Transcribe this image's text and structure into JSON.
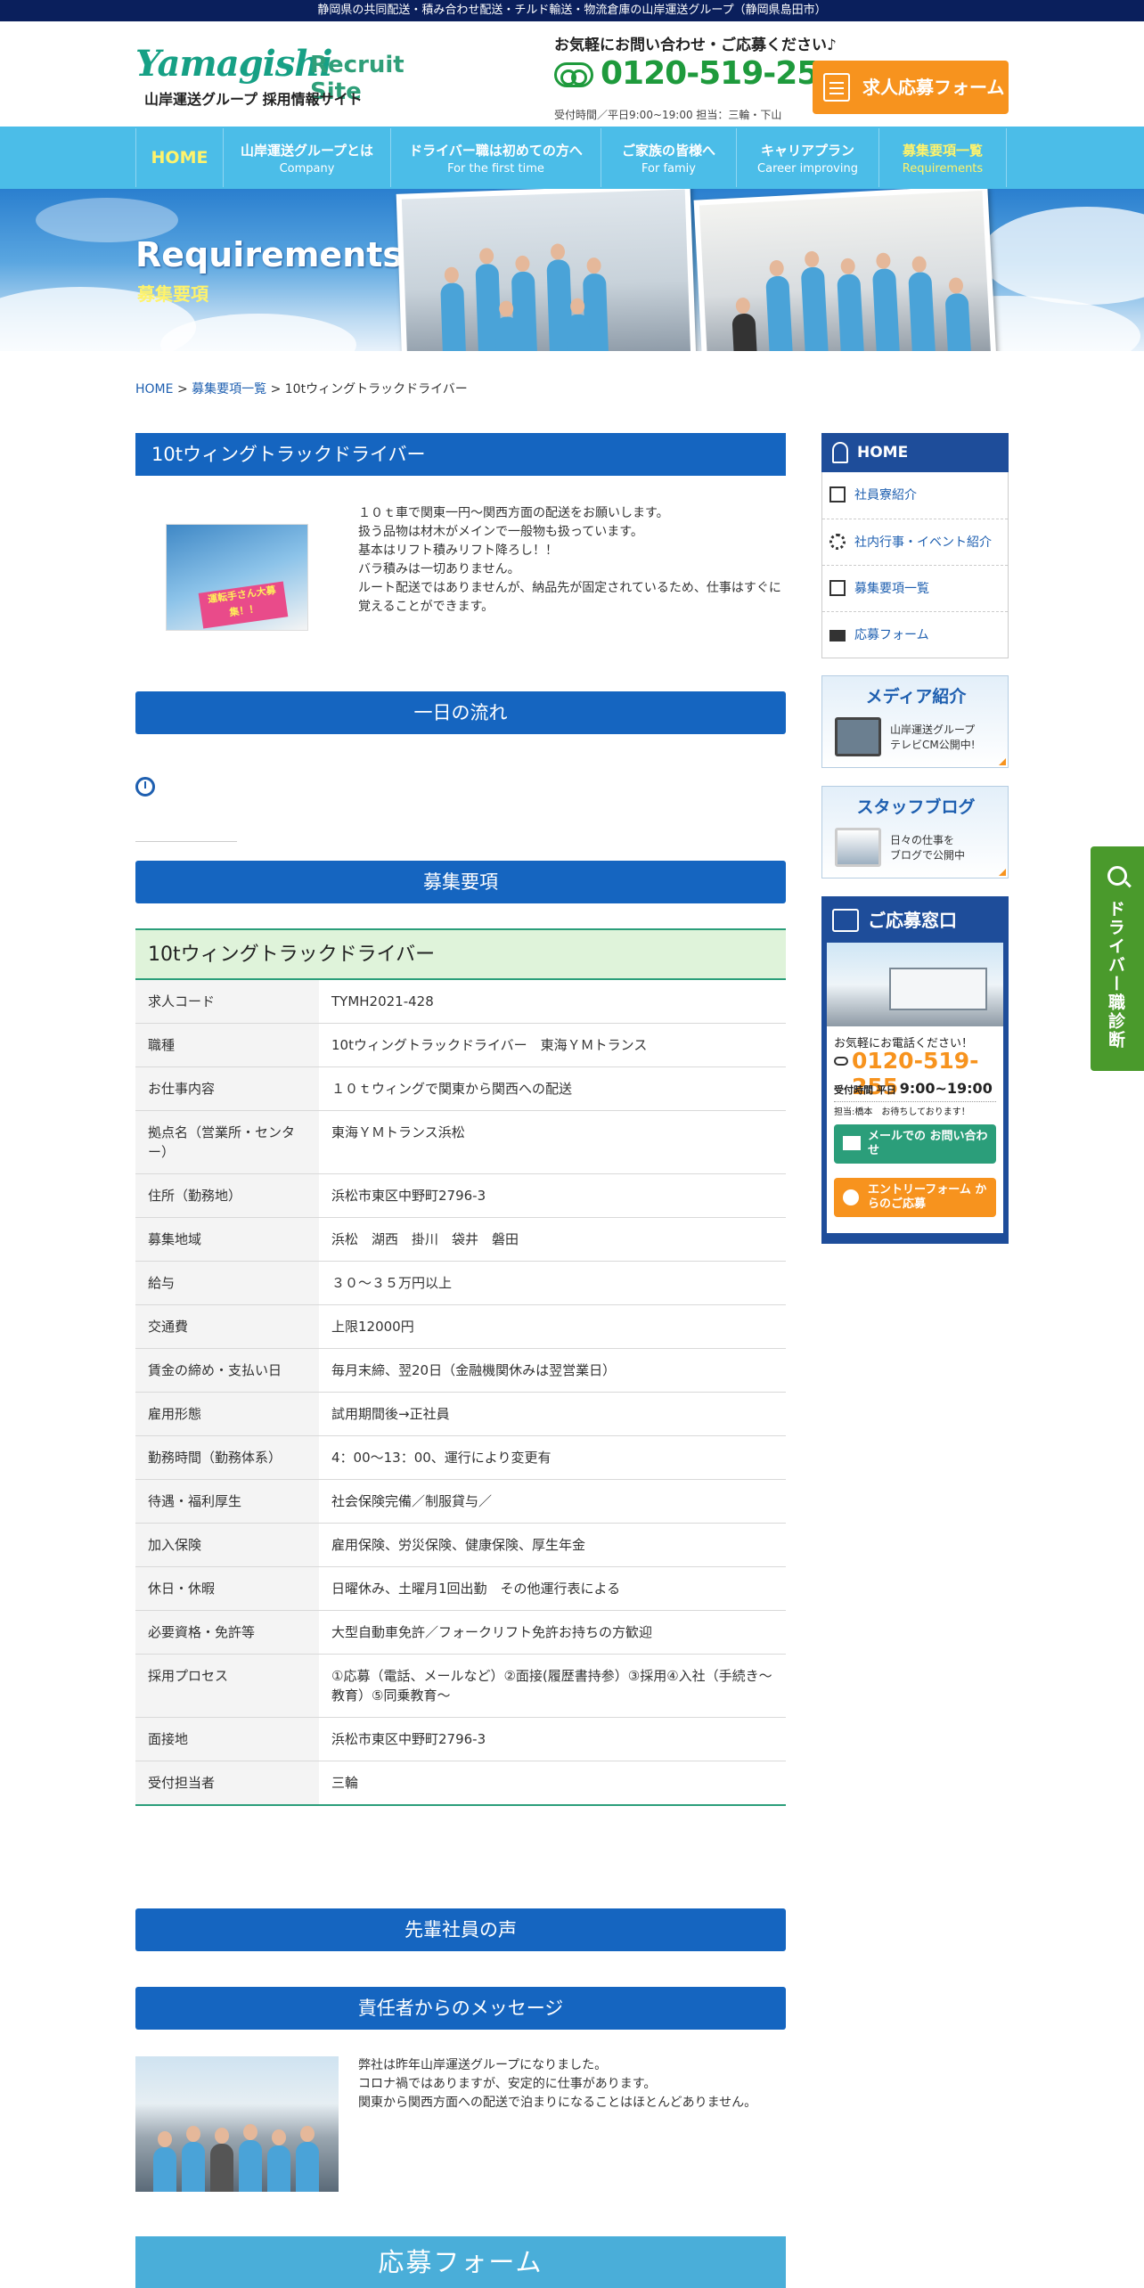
{
  "topbar": {
    "text": "静岡県の共同配送・積み合わせ配送・チルド輸送・物流倉庫の山岸運送グループ（静岡県島田市）"
  },
  "header": {
    "logo_text": "Yamagishi",
    "logo_recruit": "Recruit Site",
    "logo_sub": "山岸運送グループ 採用情報サイト",
    "contact_lead": "お気軽にお問い合わせ・ご応募ください♪",
    "phone": "0120-519-255",
    "hours": "受付時間／平日9:00~19:00 担当：三輪・下山",
    "apply_label": "求人応募フォーム"
  },
  "nav": [
    {
      "jp": "HOME",
      "en": ""
    },
    {
      "jp": "山岸運送グループとは",
      "en": "Company"
    },
    {
      "jp": "ドライバー職は初めての方へ",
      "en": "For the first time"
    },
    {
      "jp": "ご家族の皆様へ",
      "en": "For famiy"
    },
    {
      "jp": "キャリアプラン",
      "en": "Career improving"
    },
    {
      "jp": "募集要項一覧",
      "en": "Requirements"
    }
  ],
  "hero": {
    "title": "Requirements",
    "subtitle": "募集要項"
  },
  "breadcrumb": {
    "home": "HOME",
    "sep": ">",
    "list": "募集要項一覧",
    "current": "10tウィングトラックドライバー"
  },
  "main": {
    "job_title": "10tウィングトラックドライバー",
    "intro_banner": "運転手さん大募集！！",
    "intro_lines": [
      "１０ｔ車で関東一円～関西方面の配送をお願いします。",
      "扱う品物は材木がメインで一般物も扱っています。",
      "基本はリフト積みリフト降ろし！！",
      "バラ積みは一切ありません。",
      "ルート配送ではありませんが、納品先が固定されているため、仕事はすぐに覚えることができます。"
    ],
    "section_flow": "一日の流れ",
    "section_requirements": "募集要項",
    "table_title": "10tウィングトラックドライバー",
    "rows": [
      {
        "k": "求人コード",
        "v": "TYMH2021-428"
      },
      {
        "k": "職種",
        "v": "10tウィングトラックドライバー　東海ＹＭトランス"
      },
      {
        "k": "お仕事内容",
        "v": "１０ｔウィングで関東から関西への配送"
      },
      {
        "k": "拠点名（営業所・センター）",
        "v": "東海ＹＭトランス浜松"
      },
      {
        "k": "住所（勤務地）",
        "v": "浜松市東区中野町2796-3"
      },
      {
        "k": "募集地域",
        "v": "浜松　湖西　掛川　袋井　磐田"
      },
      {
        "k": "給与",
        "v": "３０～３５万円以上"
      },
      {
        "k": "交通費",
        "v": "上限12000円"
      },
      {
        "k": "賃金の締め・支払い日",
        "v": "毎月末締、翌20日（金融機関休みは翌営業日）"
      },
      {
        "k": "雇用形態",
        "v": "試用期間後→正社員"
      },
      {
        "k": "勤務時間（勤務体系）",
        "v": "4：00～13：00、運行により変更有"
      },
      {
        "k": "待遇・福利厚生",
        "v": "社会保険完備／制服貸与／"
      },
      {
        "k": "加入保険",
        "v": "雇用保険、労災保険、健康保険、厚生年金"
      },
      {
        "k": "休日・休暇",
        "v": "日曜休み、土曜月1回出勤　その他運行表による"
      },
      {
        "k": "必要資格・免許等",
        "v": "大型自動車免許／フォークリフト免許お持ちの方歓迎"
      },
      {
        "k": "採用プロセス",
        "v": "①応募（電話、メールなど）②面接(履歴書持参）③採用④入社（手続き～教育）⑤同乗教育～"
      },
      {
        "k": "面接地",
        "v": "浜松市東区中野町2796-3"
      },
      {
        "k": "受付担当者",
        "v": "三輪"
      }
    ],
    "section_voice": "先輩社員の声",
    "section_message": "責任者からのメッセージ",
    "message_lines": [
      "弊社は昨年山岸運送グループになりました。",
      "コロナ禍ではありますが、安定的に仕事があります。",
      "関東から関西方面への配送で泊まりになることはほとんどありません。"
    ],
    "section_form": "応募フォーム"
  },
  "sidebar": {
    "home": "HOME",
    "menu": [
      "社員寮紹介",
      "社内行事・イベント紹介",
      "募集要項一覧",
      "応募フォーム"
    ],
    "media": {
      "title": "メディア紹介",
      "line1": "山岸運送グループ",
      "line2": "テレビCM公開中!"
    },
    "blog": {
      "title": "スタッフブログ",
      "line1": "日々の仕事を",
      "line2": "ブログで公開中"
    },
    "contact": {
      "title": "ご応募窓口",
      "lead": "お気軽にお電話ください！",
      "phone": "0120-519-255",
      "hours_label": "受付時間 平日",
      "hours": "9:00~19:00",
      "person": "担当:橋本　お待ちしております！",
      "mail_btn": "メールでの お問い合わせ",
      "entry_btn": "エントリーフォーム からのご応募"
    }
  },
  "side_tab": {
    "label": "ドライバー職診断"
  }
}
